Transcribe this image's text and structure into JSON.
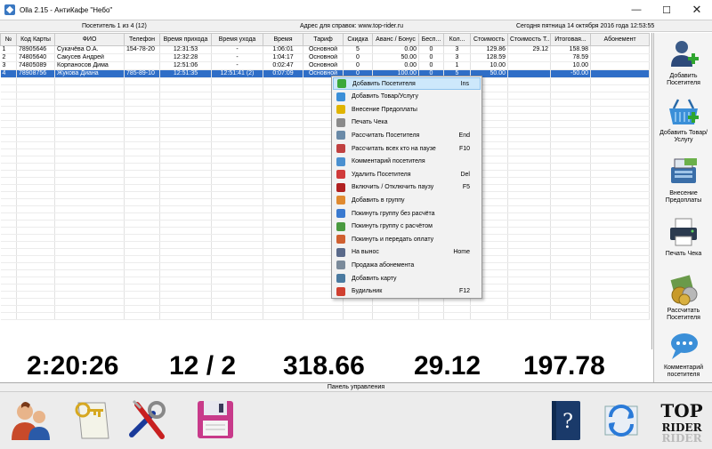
{
  "window": {
    "title": "Olla 2.15 - АнтиКафе \"Небо\"",
    "minimize": "—",
    "maximize": "☐",
    "close": "✕"
  },
  "infobar": {
    "visitor_counter": "Посетитель  1  из  4 (12)",
    "address": "Адрес для справок: www.top-rider.ru",
    "datetime": "Сегодня  пятница  14 октября 2016 года  12:53:55"
  },
  "table": {
    "headers": [
      "№",
      "Код Карты",
      "ФИО",
      "Телефон",
      "Время прихода",
      "Время ухода",
      "Время",
      "Тариф",
      "Скидка",
      "Аванс / Бонус",
      "Бесп...",
      "Кол...",
      "Стоимость",
      "Стоимость Т...",
      "Итоговая...",
      "Абонемент"
    ],
    "rows": [
      [
        "1",
        "78905646",
        "Сукачёва О.А.",
        "154-78-20",
        "12:31:53",
        "-",
        "1:06:01",
        "Основной",
        "5",
        "0.00",
        "0",
        "3",
        "129.86",
        "29.12",
        "158.98",
        ""
      ],
      [
        "2",
        "74805640",
        "Сакусев Андрей",
        "",
        "12:32:28",
        "-",
        "1:04:17",
        "Основной",
        "0",
        "50.00",
        "0",
        "3",
        "128.59",
        "",
        "78.59",
        ""
      ],
      [
        "3",
        "74805089",
        "Корпаносов Дима",
        "",
        "12:51:06",
        "-",
        "0:02:47",
        "Основной",
        "0",
        "0.00",
        "0",
        "1",
        "10.00",
        "",
        "10.00",
        ""
      ],
      [
        "4",
        "78908756",
        "Жукова Диана",
        "785-89-10",
        "12:51:35",
        "12:51:41 (2)",
        "0:07:09",
        "Основной",
        "0",
        "100.00",
        "0",
        "5",
        "50.00",
        "",
        "-50.00",
        ""
      ]
    ],
    "selected_row": 4
  },
  "context_menu": {
    "items": [
      {
        "label": "Добавить Посетителя",
        "shortcut": "Ins",
        "icon": "add-visitor-icon",
        "color": "#3aa83a"
      },
      {
        "label": "Добавить Товар/Услугу",
        "shortcut": "",
        "icon": "add-goods-icon",
        "color": "#3b8fd8"
      },
      {
        "label": "Внесение Предоплаты",
        "shortcut": "",
        "icon": "prepayment-icon",
        "color": "#e0b400"
      },
      {
        "label": "Печать Чека",
        "shortcut": "",
        "icon": "print-receipt-icon",
        "color": "#8a8a8a"
      },
      {
        "label": "Рассчитать Посетителя",
        "shortcut": "End",
        "icon": "checkout-clock-icon",
        "color": "#6a8aa8"
      },
      {
        "label": "Рассчитать всех кто на паузе",
        "shortcut": "F10",
        "icon": "checkout-paused-icon",
        "color": "#c04040"
      },
      {
        "label": "Комментарий посетителя",
        "shortcut": "",
        "icon": "comment-icon",
        "color": "#4a90d0"
      },
      {
        "label": "Удалить Посетителя",
        "shortcut": "Del",
        "icon": "delete-visitor-icon",
        "color": "#d03a3a"
      },
      {
        "label": "Включить / Отключить паузу",
        "shortcut": "F5",
        "icon": "pause-icon",
        "color": "#b02020"
      },
      {
        "label": "Добавить в группу",
        "shortcut": "",
        "icon": "group-add-icon",
        "color": "#e08a30"
      },
      {
        "label": "Покинуть группу без расчёта",
        "shortcut": "",
        "icon": "group-leave-icon",
        "color": "#3a7ad0"
      },
      {
        "label": "Покинуть группу с расчётом",
        "shortcut": "",
        "icon": "group-leave-pay-icon",
        "color": "#4a9a40"
      },
      {
        "label": "Покинуть и передать оплату",
        "shortcut": "",
        "icon": "group-transfer-icon",
        "color": "#d06030"
      },
      {
        "label": "На вынос",
        "shortcut": "Home",
        "icon": "takeaway-icon",
        "color": "#5a6a8a"
      },
      {
        "label": "Продажа абонемента",
        "shortcut": "",
        "icon": "subscription-icon",
        "color": "#7a8a9a"
      },
      {
        "label": "Добавить карту",
        "shortcut": "",
        "icon": "add-card-icon",
        "color": "#4a7aa0"
      },
      {
        "label": "Будильник",
        "shortcut": "F12",
        "icon": "alarm-icon",
        "color": "#d04030"
      }
    ],
    "highlighted": 0
  },
  "sidebar": {
    "buttons": [
      {
        "label": "Добавить Посетителя",
        "icon": "add-visitor-icon"
      },
      {
        "label": "Добавить Товар/Услугу",
        "icon": "shopping-basket-icon"
      },
      {
        "label": "Внесение Предоплаты",
        "icon": "cash-register-icon"
      },
      {
        "label": "Печать Чека",
        "icon": "printer-icon"
      },
      {
        "label": "Рассчитать Посетителя",
        "icon": "checkout-coins-icon"
      },
      {
        "label": "Комментарий посетителя",
        "icon": "speech-bubble-icon"
      }
    ]
  },
  "counters": {
    "time": "2:20:26",
    "visitors": "12 / 2",
    "total": "318.66",
    "goods": "29.12",
    "final": "197.78"
  },
  "panel": {
    "label": "Панель управления",
    "buttons": [
      "users-icon",
      "keys-icon",
      "tools-icon",
      "save-disk-icon",
      "help-book-icon",
      "sync-icon",
      "top-rider-logo"
    ],
    "logo_text_1": "TOP",
    "logo_text_2": "RIDER"
  },
  "colors": {
    "selection": "#2f6ec7",
    "menu_highlight": "#cde8fb"
  }
}
